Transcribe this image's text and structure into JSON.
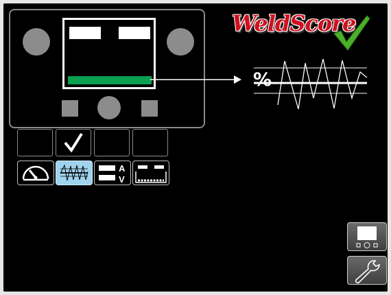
{
  "logo": {
    "text": "WeldScore",
    "brand_color": "#d0101e",
    "check_color": "#4caf2a"
  },
  "weld_graph": {
    "unit_symbol": "%"
  },
  "machine_panel": {
    "bar_color": "#0aa050"
  },
  "tabs": [
    {
      "id": "slot-1",
      "selected": false
    },
    {
      "id": "slot-2",
      "selected": true,
      "icon": "checkmark-icon"
    },
    {
      "id": "slot-3",
      "selected": false
    },
    {
      "id": "slot-4",
      "selected": false
    }
  ],
  "modes": [
    {
      "id": "gauge",
      "icon": "gauge-icon",
      "active": false
    },
    {
      "id": "waveform",
      "icon": "waveform-icon",
      "active": true
    },
    {
      "id": "amps-volts",
      "icon": "amps-volts-icon",
      "labels": [
        "A",
        "V"
      ],
      "active": false
    },
    {
      "id": "meters-bar",
      "icon": "meters-bar-icon",
      "active": false
    }
  ],
  "side_buttons": [
    {
      "id": "display",
      "icon": "display-panel-icon"
    },
    {
      "id": "settings",
      "icon": "wrench-icon"
    }
  ]
}
